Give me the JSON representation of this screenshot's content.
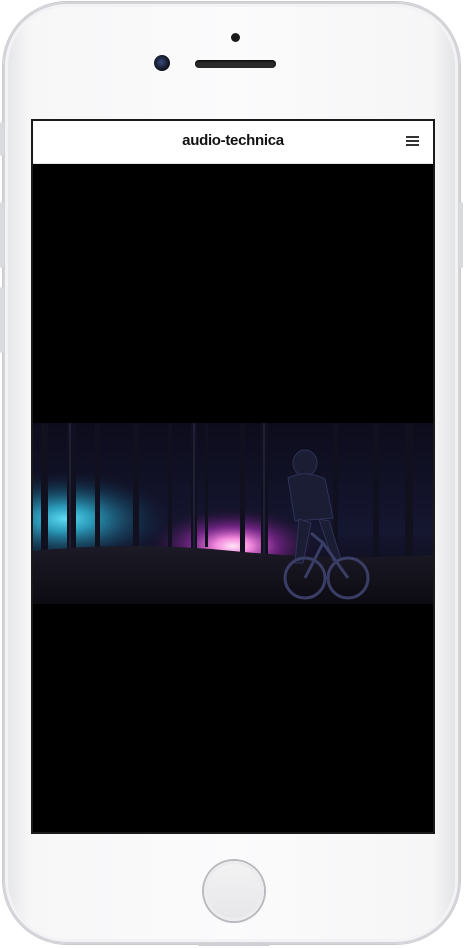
{
  "site": {
    "brand": "audio-technica",
    "menu_icon": "hamburger-menu-icon"
  },
  "device": {
    "model": "smartphone",
    "color": "#f7f7f8"
  },
  "hero": {
    "video_description_colors": {
      "magenta_glow": "#e64bdc",
      "cyan_glow": "#2fb9d9",
      "background": "#000000"
    }
  }
}
